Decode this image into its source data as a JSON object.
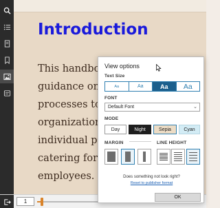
{
  "sidebar": {
    "items": [
      {
        "icon": "search-icon"
      },
      {
        "icon": "list-icon"
      },
      {
        "icon": "bookmarks-icon"
      },
      {
        "icon": "bookmark-icon"
      },
      {
        "icon": "image-icon"
      },
      {
        "icon": "notes-icon"
      }
    ]
  },
  "book": {
    "heading": "Introduction",
    "lines": [
      "This handboo",
      "guidance on h",
      "processes to in",
      "organizational",
      "individual per",
      "catering for th",
      "employees. Re"
    ]
  },
  "view_options": {
    "title": "View options",
    "text_size_label": "Text Size",
    "text_sizes": [
      "Aa",
      "Aa",
      "Aa",
      "Aa"
    ],
    "selected_text_size": 3,
    "font_label": "FONT",
    "font_value": "Default Font",
    "mode_label": "MODE",
    "modes": [
      "Day",
      "Night",
      "Sepia",
      "Cyan"
    ],
    "selected_mode": "Sepia",
    "margin_label": "MARGIN",
    "line_height_label": "LINE HEIGHT",
    "question": "Does something not look right?",
    "reset_link": "Reset to publisher format",
    "ok_label": "OK"
  },
  "footer": {
    "page_number": "1",
    "progress": 0.02
  },
  "colors": {
    "accent": "#2f7fb0",
    "heading": "#1a1adb",
    "sepia_page": "#e8d9c6",
    "progress": "#d9832a"
  }
}
